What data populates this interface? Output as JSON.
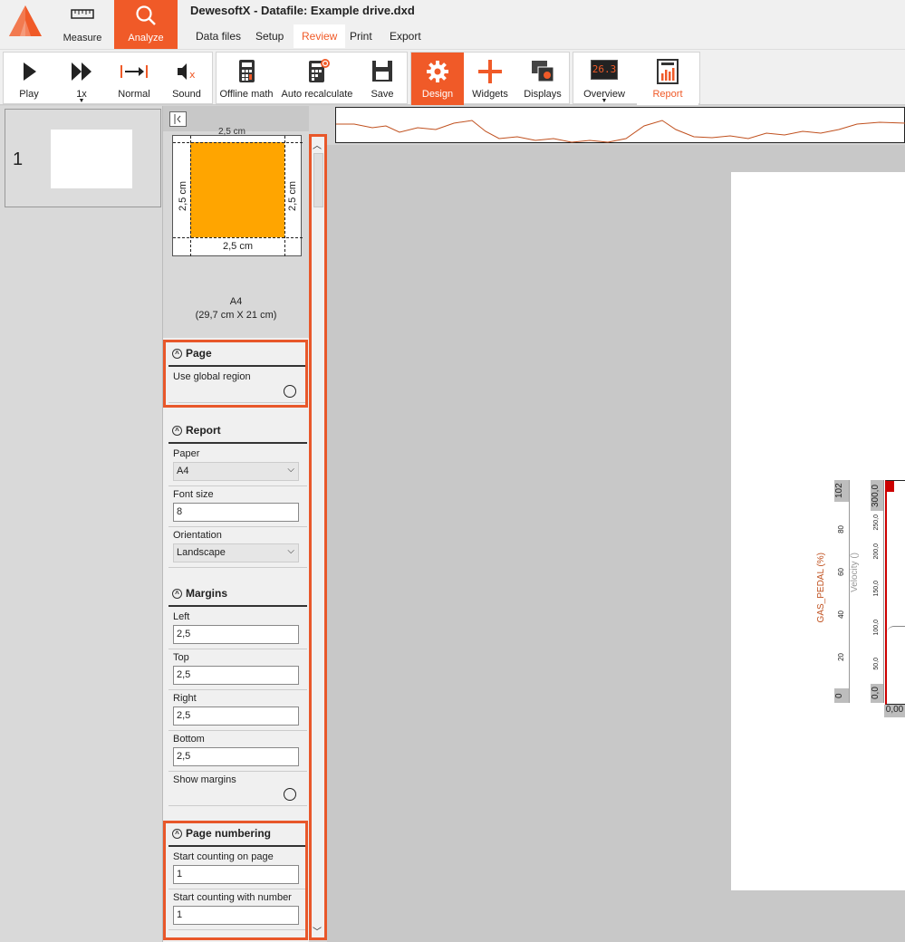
{
  "app": {
    "title": "DewesoftX - Datafile: Example drive.dxd"
  },
  "mode_tabs": [
    {
      "label": "Measure"
    },
    {
      "label": "Analyze"
    }
  ],
  "menu": {
    "data_files": "Data files",
    "setup": "Setup",
    "review": "Review",
    "print": "Print",
    "export": "Export"
  },
  "toolbar": {
    "play": "Play",
    "speed": "1x",
    "normal": "Normal",
    "sound": "Sound",
    "offline_math": "Offline math",
    "auto_recalc": "Auto recalculate",
    "save": "Save",
    "design": "Design",
    "widgets": "Widgets",
    "displays": "Displays",
    "overview": "Overview",
    "overview_value": "26.3",
    "report": "Report"
  },
  "pagelist": {
    "pages": [
      {
        "number": "1"
      }
    ]
  },
  "preview": {
    "margin_top": "2,5 cm",
    "margin_left": "2,5 cm",
    "margin_right": "2,5 cm",
    "margin_bottom": "2,5 cm",
    "paper_name": "A4",
    "paper_dims": "(29,7 cm X 21 cm)"
  },
  "page_section": {
    "title": "Page",
    "use_global_region_label": "Use global region",
    "use_global_region": false
  },
  "report_section": {
    "title": "Report",
    "paper_label": "Paper",
    "paper_value": "A4",
    "font_size_label": "Font size",
    "font_size_value": "8",
    "orientation_label": "Orientation",
    "orientation_value": "Landscape"
  },
  "margins_section": {
    "title": "Margins",
    "left_label": "Left",
    "left_value": "2,5",
    "top_label": "Top",
    "top_value": "2,5",
    "right_label": "Right",
    "right_value": "2,5",
    "bottom_label": "Bottom",
    "bottom_value": "2,5",
    "show_margins_label": "Show margins",
    "show_margins": false
  },
  "numbering_section": {
    "title": "Page numbering",
    "start_page_label": "Start counting on page",
    "start_page_value": "1",
    "start_number_label": "Start counting with number",
    "start_number_value": "1"
  },
  "report_preview": {
    "gas_pedal_axis": "GAS_PEDAL (%)",
    "velocity_axis": "Velocity ()",
    "gas_max": "102",
    "gas_ticks": [
      "80",
      "60",
      "40",
      "20"
    ],
    "gas_min": "0",
    "vel_max": "300,0",
    "vel_ticks": [
      "250,0",
      "200,0",
      "150,0",
      "100,0",
      "50,0"
    ],
    "vel_min": "0,0",
    "x_start": "0,00",
    "gas_color": "#c0501e",
    "accent": "#f05a28"
  }
}
